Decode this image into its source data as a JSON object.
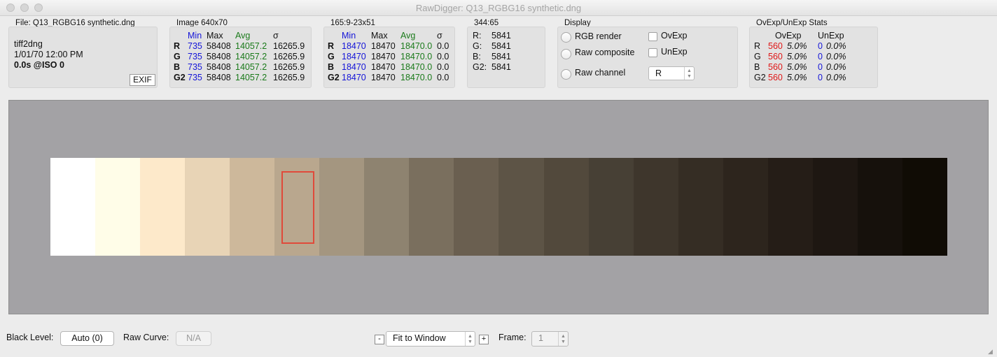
{
  "window": {
    "title": "RawDigger: Q13_RGBG16 synthetic.dng"
  },
  "file_panel": {
    "title": "File: Q13_RGBG16 synthetic.dng",
    "software": "tiff2dng",
    "datetime": "1/01/70 12:00 PM",
    "exposure": "0.0s @ISO 0",
    "exif_label": "EXIF"
  },
  "image_panel": {
    "title": "Image 640x70",
    "headers": {
      "min": "Min",
      "max": "Max",
      "avg": "Avg",
      "sigma": "σ"
    },
    "rows": [
      {
        "ch": "R",
        "min": "735",
        "max": "58408",
        "avg": "14057.2",
        "sigma": "16265.9"
      },
      {
        "ch": "G",
        "min": "735",
        "max": "58408",
        "avg": "14057.2",
        "sigma": "16265.9"
      },
      {
        "ch": "B",
        "min": "735",
        "max": "58408",
        "avg": "14057.2",
        "sigma": "16265.9"
      },
      {
        "ch": "G2",
        "min": "735",
        "max": "58408",
        "avg": "14057.2",
        "sigma": "16265.9"
      }
    ]
  },
  "selection_panel": {
    "title": "165:9-23x51",
    "headers": {
      "min": "Min",
      "max": "Max",
      "avg": "Avg",
      "sigma": "σ"
    },
    "rows": [
      {
        "ch": "R",
        "min": "18470",
        "max": "18470",
        "avg": "18470.0",
        "sigma": "0.0"
      },
      {
        "ch": "G",
        "min": "18470",
        "max": "18470",
        "avg": "18470.0",
        "sigma": "0.0"
      },
      {
        "ch": "B",
        "min": "18470",
        "max": "18470",
        "avg": "18470.0",
        "sigma": "0.0"
      },
      {
        "ch": "G2",
        "min": "18470",
        "max": "18470",
        "avg": "18470.0",
        "sigma": "0.0"
      }
    ]
  },
  "pixel_panel": {
    "title": "344:65",
    "rows": [
      {
        "ch": "R:",
        "value": "5841"
      },
      {
        "ch": "G:",
        "value": "5841"
      },
      {
        "ch": "B:",
        "value": "5841"
      },
      {
        "ch": "G2:",
        "value": "5841"
      }
    ]
  },
  "display_panel": {
    "title": "Display",
    "rgb_render": "RGB render",
    "raw_composite": "Raw composite",
    "raw_channel": "Raw channel",
    "ovexp": "OvExp",
    "unexp": "UnExp",
    "channel_value": "R"
  },
  "ovunexp_panel": {
    "title": "OvExp/UnExp Stats",
    "headers": {
      "ovexp": "OvExp",
      "unexp": "UnExp"
    },
    "rows": [
      {
        "ch": "R",
        "ov_count": "560",
        "ov_pct": "5.0%",
        "un_count": "0",
        "un_pct": "0.0%"
      },
      {
        "ch": "G",
        "ov_count": "560",
        "ov_pct": "5.0%",
        "un_count": "0",
        "un_pct": "0.0%"
      },
      {
        "ch": "B",
        "ov_count": "560",
        "ov_pct": "5.0%",
        "un_count": "0",
        "un_pct": "0.0%"
      },
      {
        "ch": "G2",
        "ov_count": "560",
        "ov_pct": "5.0%",
        "un_count": "0",
        "un_pct": "0.0%"
      }
    ]
  },
  "preview": {
    "background": "#a3a2a5",
    "patches": [
      "#ffffff",
      "#fffde8",
      "#fde9ca",
      "#e8d4b6",
      "#cdb89b",
      "#b9a78e",
      "#a49680",
      "#8e8370",
      "#7a6f5e",
      "#6a5f50",
      "#5d5446",
      "#52493c",
      "#474035",
      "#3e362c",
      "#352d24",
      "#2d251d",
      "#251d17",
      "#1e1712",
      "#16110c",
      "#100c05"
    ],
    "roi_color": "#e04a3a"
  },
  "bottom_bar": {
    "black_level_label": "Black Level:",
    "black_level_value": "Auto (0)",
    "raw_curve_label": "Raw Curve:",
    "raw_curve_value": "N/A",
    "zoom_minus": "-",
    "zoom_value": "Fit to Window",
    "zoom_plus": "+",
    "frame_label": "Frame:",
    "frame_value": "1"
  }
}
